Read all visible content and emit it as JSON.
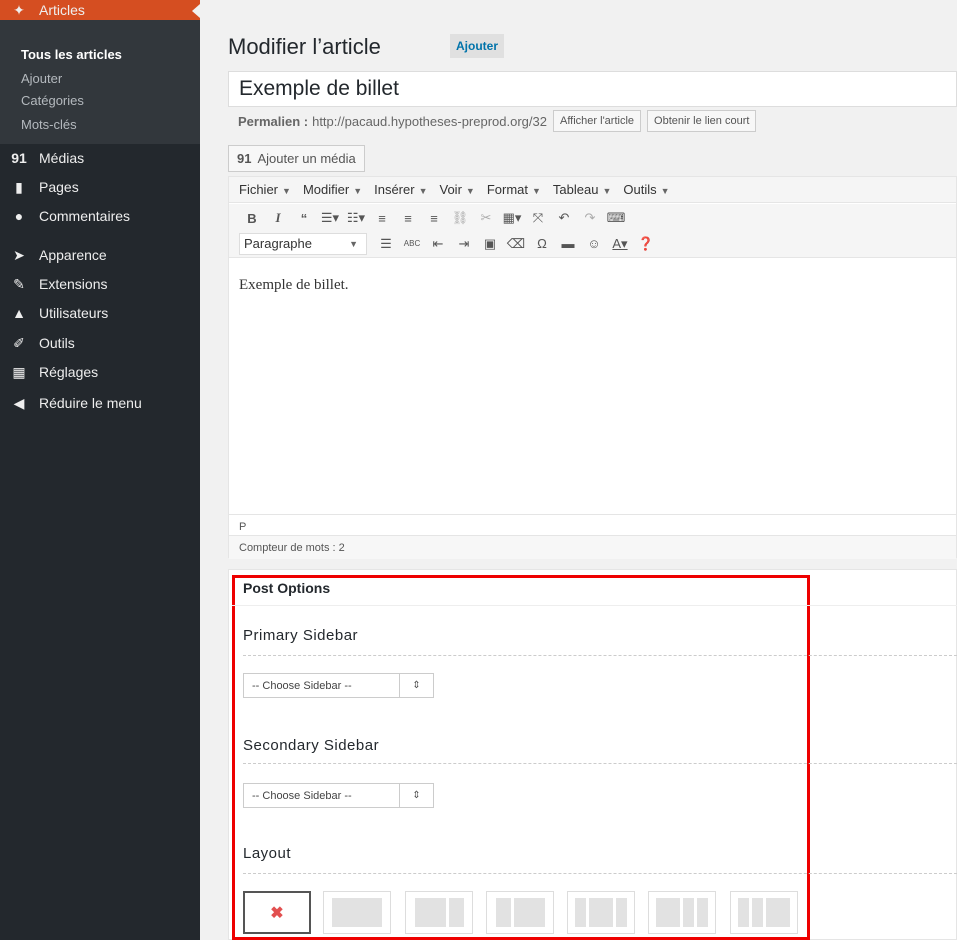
{
  "sidebar": {
    "current_menu": {
      "label": "Articles",
      "icon": "pushpin-icon"
    },
    "submenu": [
      "Tous les articles",
      "Ajouter",
      "Catégories",
      "Mots-clés"
    ],
    "items": [
      {
        "label": "Médias",
        "icon": "media-icon"
      },
      {
        "label": "Pages",
        "icon": "pages-icon"
      },
      {
        "label": "Commentaires",
        "icon": "comment-icon"
      },
      {
        "label": "Apparence",
        "icon": "brush-icon"
      },
      {
        "label": "Extensions",
        "icon": "plugin-icon"
      },
      {
        "label": "Utilisateurs",
        "icon": "users-icon"
      },
      {
        "label": "Outils",
        "icon": "wrench-icon"
      },
      {
        "label": "Réglages",
        "icon": "settings-icon"
      },
      {
        "label": "Réduire le menu",
        "icon": "collapse-icon"
      }
    ]
  },
  "header": {
    "title": "Modifier l’article",
    "add_new": "Ajouter"
  },
  "post": {
    "title": "Exemple de billet",
    "permalink_label": "Permalien :",
    "permalink_url": "http://pacaud.hypotheses-preprod.org/32",
    "view_button": "Afficher l'article",
    "shortlink_button": "Obtenir le lien court"
  },
  "media": {
    "add_media": "Ajouter un média"
  },
  "editor": {
    "menus": [
      "Fichier",
      "Modifier",
      "Insérer",
      "Voir",
      "Format",
      "Tableau",
      "Outils"
    ],
    "format": "Paragraphe",
    "content": "Exemple de billet.",
    "path": "P",
    "word_count": "Compteur de mots : 2"
  },
  "post_options": {
    "title": "Post Options",
    "primary_sidebar": {
      "label": "Primary Sidebar",
      "value": "-- Choose Sidebar --"
    },
    "secondary_sidebar": {
      "label": "Secondary Sidebar",
      "value": "-- Choose Sidebar --"
    },
    "layout": {
      "label": "Layout",
      "selected": 0,
      "option_count": 7
    }
  },
  "colors": {
    "sidebar_bg": "#23282d",
    "accent": "#d54e21",
    "highlight": "#ee0000",
    "link": "#0073aa"
  }
}
